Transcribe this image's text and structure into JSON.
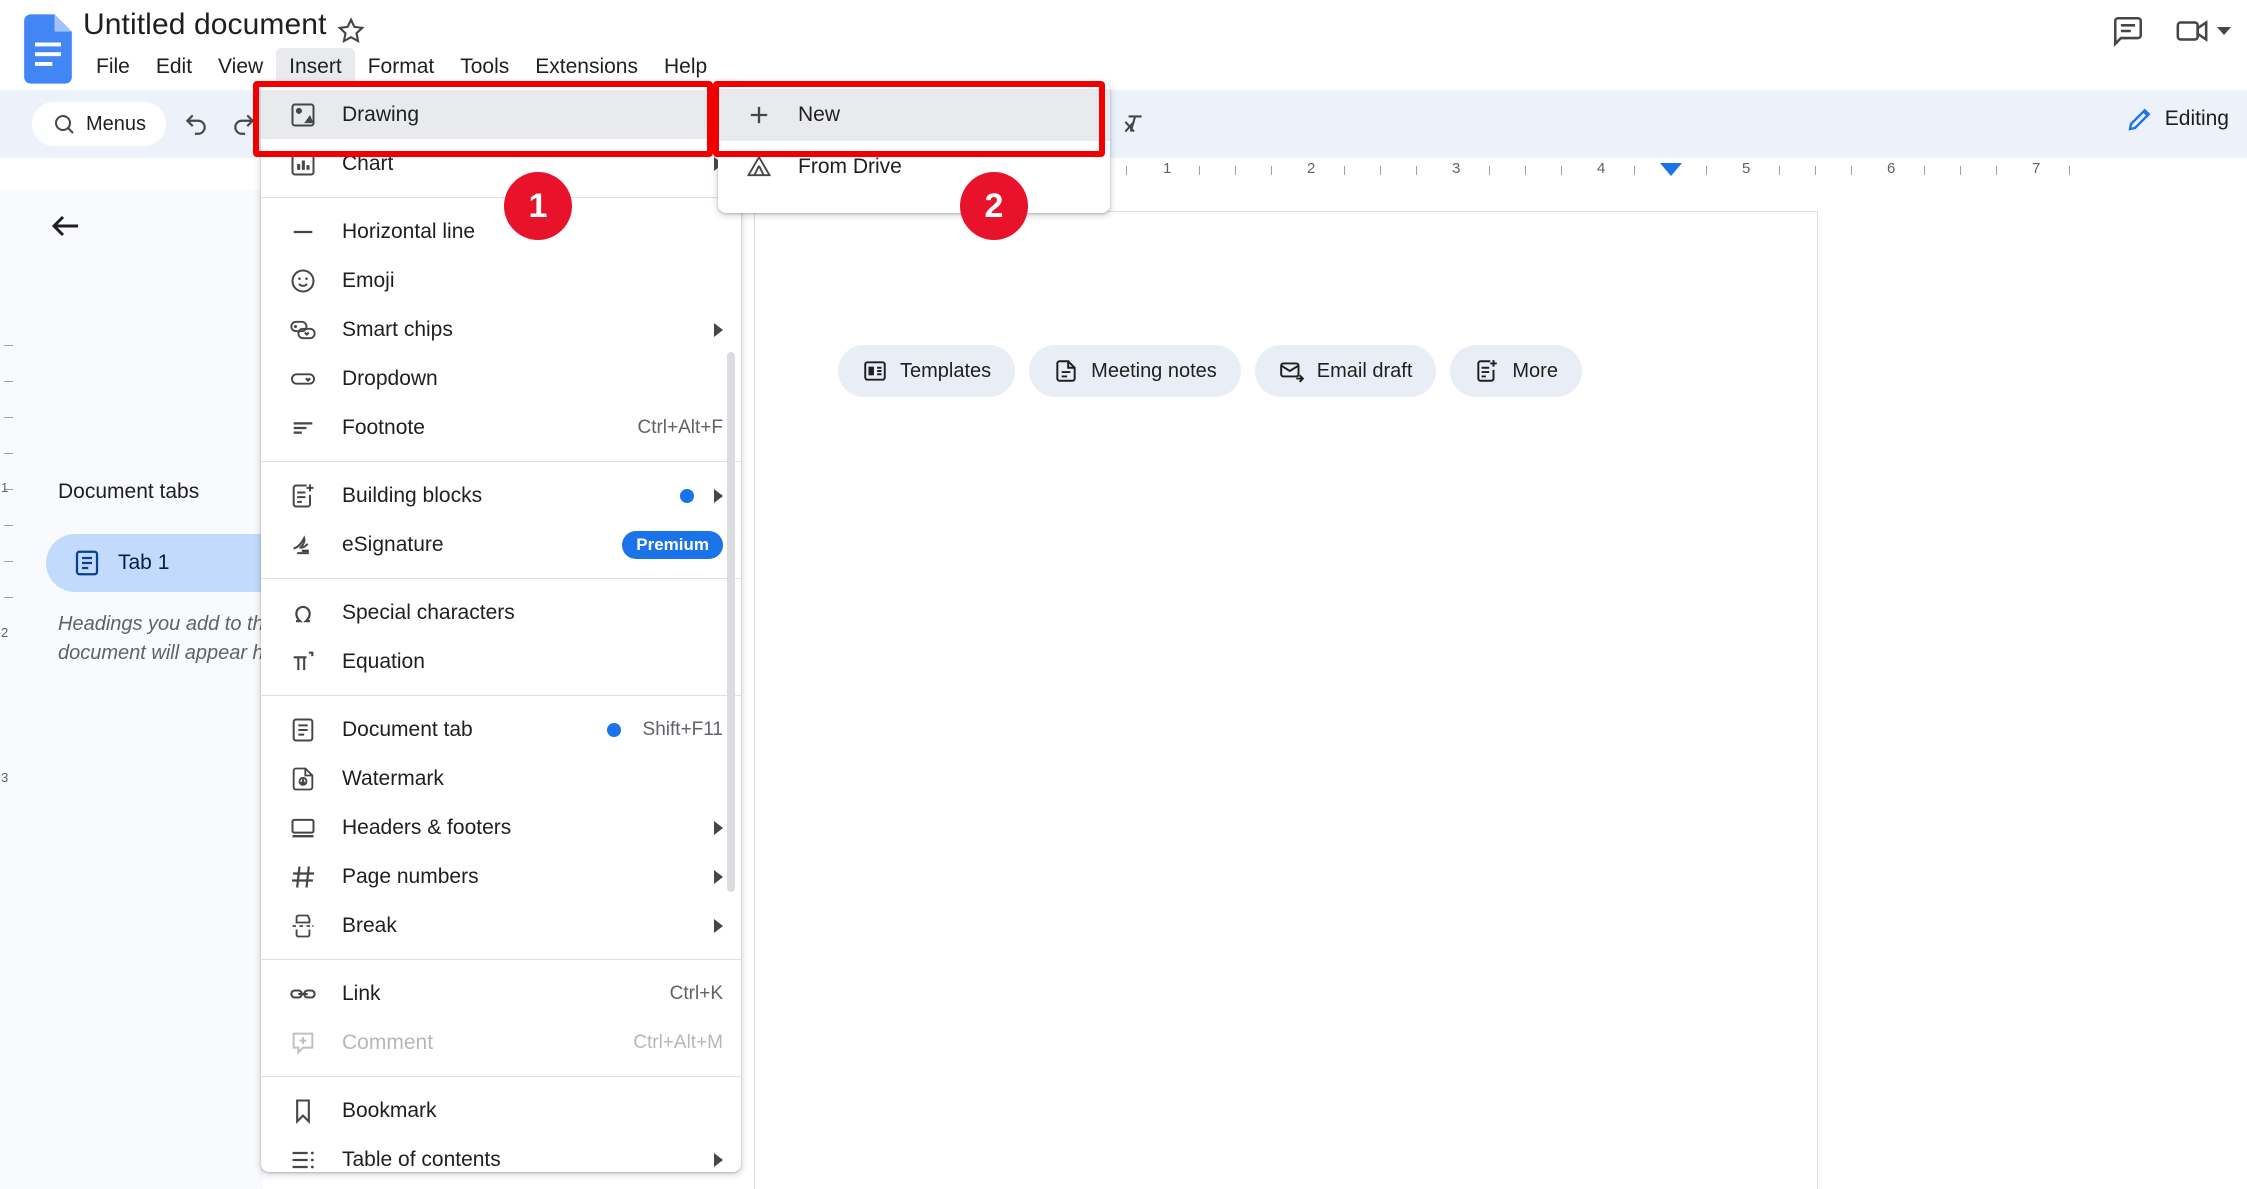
{
  "app": {
    "doc_title": "Untitled document",
    "logo_icon": "google-docs-logo",
    "star_icon": "star-outline-icon"
  },
  "menubar": {
    "items": [
      {
        "label": "File",
        "active": false
      },
      {
        "label": "Edit",
        "active": false
      },
      {
        "label": "View",
        "active": false
      },
      {
        "label": "Insert",
        "active": true
      },
      {
        "label": "Format",
        "active": false
      },
      {
        "label": "Tools",
        "active": false
      },
      {
        "label": "Extensions",
        "active": false
      },
      {
        "label": "Help",
        "active": false
      }
    ]
  },
  "topright": {
    "comment_history_icon": "comment-history-icon",
    "meet_icon": "video-camera-icon",
    "meet_caret_icon": "chevron-down-icon"
  },
  "toolbar": {
    "menus_label": "Menus",
    "search_icon": "search-icon",
    "editing_label": "Editing",
    "pencil_icon": "pencil-icon",
    "buttons": [
      {
        "name": "undo-button",
        "icon": "undo-icon"
      },
      {
        "name": "redo-button",
        "icon": "redo-icon"
      },
      {
        "name": "print-button",
        "icon": "print-icon"
      },
      {
        "name": "spellcheck-button",
        "icon": "spellcheck-icon"
      },
      {
        "name": "paint-format-button",
        "icon": "paint-roller-icon"
      },
      {
        "name": "underline-button",
        "icon": "underline-icon"
      },
      {
        "name": "text-color-button",
        "icon": "text-color-icon"
      },
      {
        "name": "highlight-color-button",
        "icon": "highlighter-icon"
      },
      {
        "name": "insert-link-button",
        "icon": "link-icon"
      },
      {
        "name": "add-comment-button",
        "icon": "comment-plus-icon"
      },
      {
        "name": "insert-image-button",
        "icon": "image-icon"
      },
      {
        "name": "align-button",
        "icon": "align-left-icon"
      },
      {
        "name": "line-spacing-button",
        "icon": "line-spacing-icon"
      },
      {
        "name": "checklist-button",
        "icon": "checklist-icon"
      },
      {
        "name": "bulleted-list-button",
        "icon": "bulleted-list-icon"
      },
      {
        "name": "numbered-list-button",
        "icon": "numbered-list-icon"
      },
      {
        "name": "decrease-indent-button",
        "icon": "decrease-indent-icon"
      },
      {
        "name": "increase-indent-button",
        "icon": "increase-indent-icon"
      },
      {
        "name": "clear-formatting-button",
        "icon": "clear-formatting-icon"
      }
    ]
  },
  "ruler": {
    "numbers": [
      "1",
      "2",
      "3",
      "4",
      "5",
      "6",
      "7"
    ]
  },
  "left_panel": {
    "back_icon": "back-arrow-icon",
    "title": "Document tabs",
    "tab": {
      "label": "Tab 1",
      "icon": "document-tab-icon"
    },
    "hint": "Headings you add to the document will appear here."
  },
  "document": {
    "chips": [
      {
        "label": "Templates",
        "icon": "templates-icon"
      },
      {
        "label": "Meeting notes",
        "icon": "document-icon"
      },
      {
        "label": "Email draft",
        "icon": "email-draft-icon"
      },
      {
        "label": "More",
        "icon": "more-blocks-icon"
      }
    ]
  },
  "insert_menu": {
    "items": [
      {
        "label": "Drawing",
        "icon": "drawing-icon",
        "shortcut": "",
        "arrow": true,
        "highlighted": true,
        "disabled": false,
        "dot": false,
        "badge": ""
      },
      {
        "label": "Chart",
        "icon": "chart-icon",
        "shortcut": "",
        "arrow": true,
        "highlighted": false,
        "disabled": false,
        "dot": false,
        "badge": ""
      },
      {
        "divider": true
      },
      {
        "label": "Horizontal line",
        "icon": "horizontal-line-icon",
        "shortcut": "",
        "arrow": false,
        "highlighted": false,
        "disabled": false,
        "dot": false,
        "badge": ""
      },
      {
        "label": "Emoji",
        "icon": "emoji-icon",
        "shortcut": "",
        "arrow": false,
        "highlighted": false,
        "disabled": false,
        "dot": false,
        "badge": ""
      },
      {
        "label": "Smart chips",
        "icon": "smart-chips-icon",
        "shortcut": "",
        "arrow": true,
        "highlighted": false,
        "disabled": false,
        "dot": false,
        "badge": ""
      },
      {
        "label": "Dropdown",
        "icon": "dropdown-icon",
        "shortcut": "",
        "arrow": false,
        "highlighted": false,
        "disabled": false,
        "dot": false,
        "badge": ""
      },
      {
        "label": "Footnote",
        "icon": "footnote-icon",
        "shortcut": "Ctrl+Alt+F",
        "arrow": false,
        "highlighted": false,
        "disabled": false,
        "dot": false,
        "badge": ""
      },
      {
        "divider": true
      },
      {
        "label": "Building blocks",
        "icon": "building-blocks-icon",
        "shortcut": "",
        "arrow": true,
        "highlighted": false,
        "disabled": false,
        "dot": true,
        "badge": ""
      },
      {
        "label": "eSignature",
        "icon": "esignature-icon",
        "shortcut": "",
        "arrow": false,
        "highlighted": false,
        "disabled": false,
        "dot": false,
        "badge": "Premium"
      },
      {
        "divider": true
      },
      {
        "label": "Special characters",
        "icon": "omega-icon",
        "shortcut": "",
        "arrow": false,
        "highlighted": false,
        "disabled": false,
        "dot": false,
        "badge": ""
      },
      {
        "label": "Equation",
        "icon": "equation-icon",
        "shortcut": "",
        "arrow": false,
        "highlighted": false,
        "disabled": false,
        "dot": false,
        "badge": ""
      },
      {
        "divider": true
      },
      {
        "label": "Document tab",
        "icon": "document-tab-icon",
        "shortcut": "Shift+F11",
        "arrow": false,
        "highlighted": false,
        "disabled": false,
        "dot": true,
        "badge": ""
      },
      {
        "label": "Watermark",
        "icon": "watermark-icon",
        "shortcut": "",
        "arrow": false,
        "highlighted": false,
        "disabled": false,
        "dot": false,
        "badge": ""
      },
      {
        "label": "Headers & footers",
        "icon": "headers-footers-icon",
        "shortcut": "",
        "arrow": true,
        "highlighted": false,
        "disabled": false,
        "dot": false,
        "badge": ""
      },
      {
        "label": "Page numbers",
        "icon": "page-numbers-icon",
        "shortcut": "",
        "arrow": true,
        "highlighted": false,
        "disabled": false,
        "dot": false,
        "badge": ""
      },
      {
        "label": "Break",
        "icon": "break-icon",
        "shortcut": "",
        "arrow": true,
        "highlighted": false,
        "disabled": false,
        "dot": false,
        "badge": ""
      },
      {
        "divider": true
      },
      {
        "label": "Link",
        "icon": "link-icon",
        "shortcut": "Ctrl+K",
        "arrow": false,
        "highlighted": false,
        "disabled": false,
        "dot": false,
        "badge": ""
      },
      {
        "label": "Comment",
        "icon": "comment-plus-icon",
        "shortcut": "Ctrl+Alt+M",
        "arrow": false,
        "highlighted": false,
        "disabled": true,
        "dot": false,
        "badge": ""
      },
      {
        "divider": true
      },
      {
        "label": "Bookmark",
        "icon": "bookmark-icon",
        "shortcut": "",
        "arrow": false,
        "highlighted": false,
        "disabled": false,
        "dot": false,
        "badge": ""
      },
      {
        "label": "Table of contents",
        "icon": "table-of-contents-icon",
        "shortcut": "",
        "arrow": true,
        "highlighted": false,
        "disabled": false,
        "dot": false,
        "badge": ""
      }
    ]
  },
  "submenu": {
    "items": [
      {
        "label": "New",
        "icon": "plus-icon",
        "highlighted": true
      },
      {
        "label": "From Drive",
        "icon": "google-drive-icon",
        "highlighted": false
      }
    ]
  },
  "annotations": {
    "step1": "1",
    "step2": "2",
    "highlight_color": "#f20000",
    "badge_color": "#e8122b"
  }
}
